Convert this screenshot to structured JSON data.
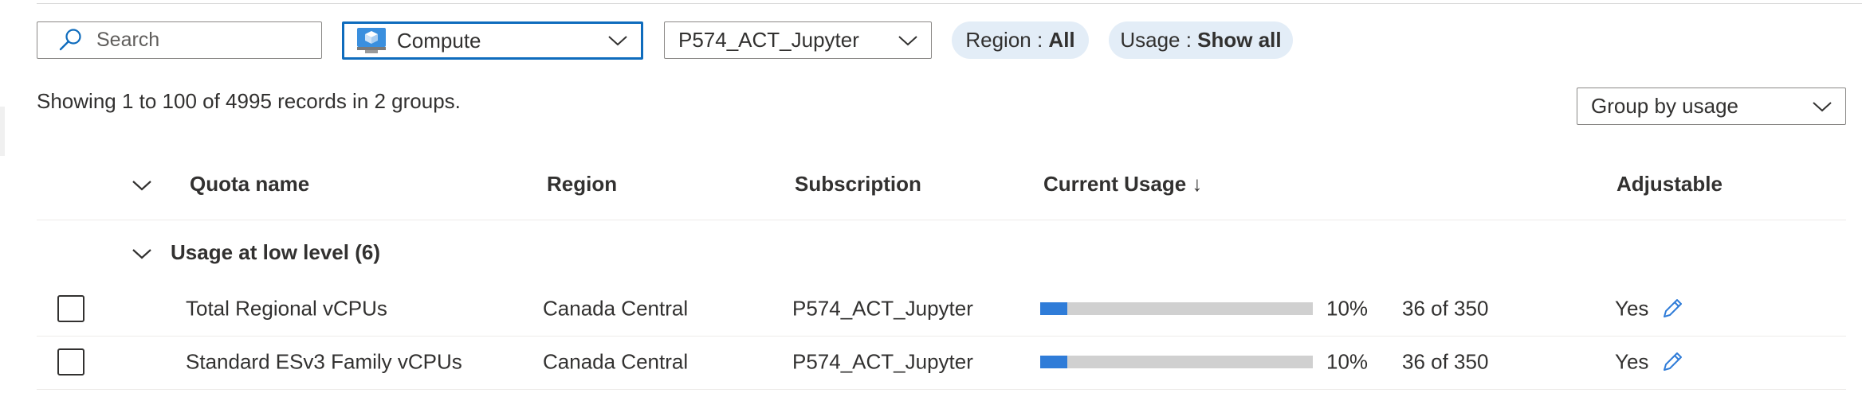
{
  "filters": {
    "search_placeholder": "Search",
    "provider": "Compute",
    "subscription": "P574_ACT_Jupyter",
    "region_key": "Region : ",
    "region_value": "All",
    "usage_key": "Usage : ",
    "usage_value": "Show all"
  },
  "records_text": "Showing 1 to 100 of 4995 records in 2 groups.",
  "group_by": "Group by usage",
  "table": {
    "columns": {
      "quota_name": "Quota name",
      "region": "Region",
      "subscription": "Subscription",
      "current_usage": "Current Usage ↓",
      "adjustable": "Adjustable"
    },
    "group": {
      "label": "Usage at low level (6)"
    },
    "rows": [
      {
        "quota_name": "Total Regional vCPUs",
        "region": "Canada Central",
        "subscription": "P574_ACT_Jupyter",
        "percent": "10%",
        "usage_fraction": 0.1,
        "count": "36 of 350",
        "adjustable": "Yes"
      },
      {
        "quota_name": "Standard ESv3 Family vCPUs",
        "region": "Canada Central",
        "subscription": "P574_ACT_Jupyter",
        "percent": "10%",
        "usage_fraction": 0.1,
        "count": "36 of 350",
        "adjustable": "Yes"
      }
    ]
  },
  "colors": {
    "accent": "#0f6cbd",
    "bar_fill": "#2f7cd8",
    "bar_track": "#d0d0d0",
    "pill_bg": "#e3edf7"
  },
  "icons": {
    "search": "search-icon",
    "compute": "compute-cube-icon",
    "chevron": "chevron-down-icon",
    "edit": "pencil-icon"
  }
}
